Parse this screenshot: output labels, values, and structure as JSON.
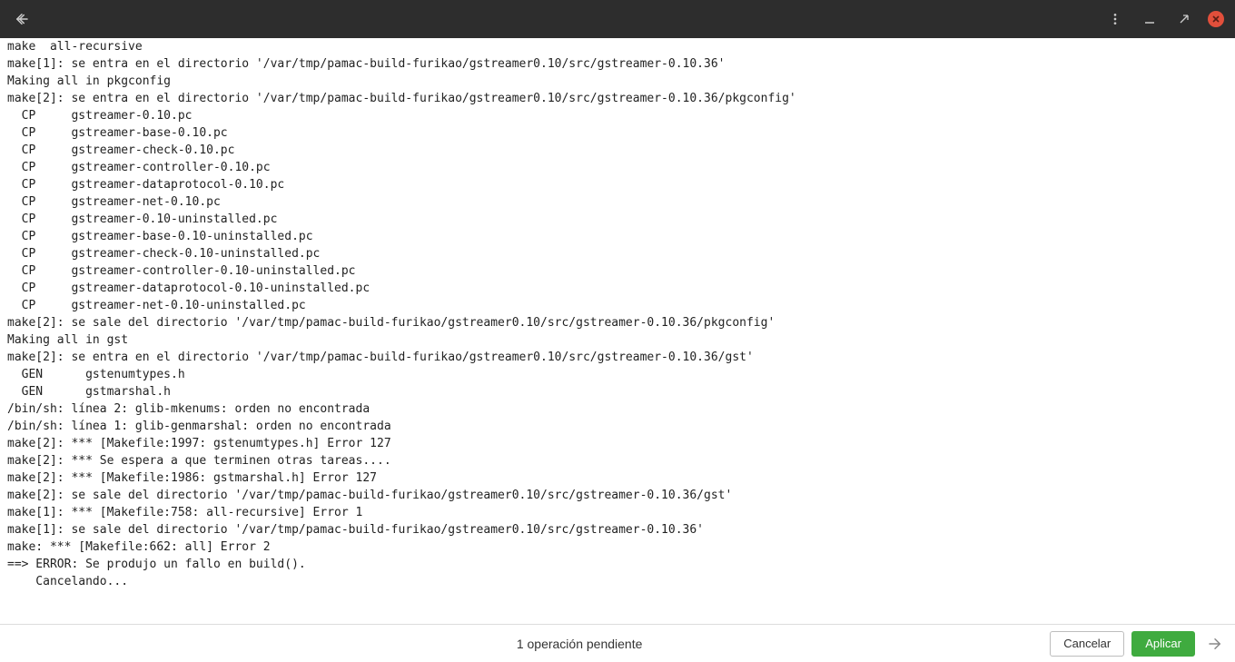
{
  "titlebar": {
    "back_icon": "back-arrow-icon",
    "menu_icon": "kebab-menu-icon",
    "minimize_icon": "minimize-icon",
    "maximize_icon": "restore-icon",
    "close_icon": "close-icon"
  },
  "terminal": {
    "lines": [
      "make  all-recursive",
      "make[1]: se entra en el directorio '/var/tmp/pamac-build-furikao/gstreamer0.10/src/gstreamer-0.10.36'",
      "Making all in pkgconfig",
      "make[2]: se entra en el directorio '/var/tmp/pamac-build-furikao/gstreamer0.10/src/gstreamer-0.10.36/pkgconfig'",
      "  CP     gstreamer-0.10.pc",
      "  CP     gstreamer-base-0.10.pc",
      "  CP     gstreamer-check-0.10.pc",
      "  CP     gstreamer-controller-0.10.pc",
      "  CP     gstreamer-dataprotocol-0.10.pc",
      "  CP     gstreamer-net-0.10.pc",
      "  CP     gstreamer-0.10-uninstalled.pc",
      "  CP     gstreamer-base-0.10-uninstalled.pc",
      "  CP     gstreamer-check-0.10-uninstalled.pc",
      "  CP     gstreamer-controller-0.10-uninstalled.pc",
      "  CP     gstreamer-dataprotocol-0.10-uninstalled.pc",
      "  CP     gstreamer-net-0.10-uninstalled.pc",
      "make[2]: se sale del directorio '/var/tmp/pamac-build-furikao/gstreamer0.10/src/gstreamer-0.10.36/pkgconfig'",
      "Making all in gst",
      "make[2]: se entra en el directorio '/var/tmp/pamac-build-furikao/gstreamer0.10/src/gstreamer-0.10.36/gst'",
      "  GEN      gstenumtypes.h",
      "  GEN      gstmarshal.h",
      "/bin/sh: línea 2: glib-mkenums: orden no encontrada",
      "/bin/sh: línea 1: glib-genmarshal: orden no encontrada",
      "make[2]: *** [Makefile:1997: gstenumtypes.h] Error 127",
      "make[2]: *** Se espera a que terminen otras tareas....",
      "make[2]: *** [Makefile:1986: gstmarshal.h] Error 127",
      "make[2]: se sale del directorio '/var/tmp/pamac-build-furikao/gstreamer0.10/src/gstreamer-0.10.36/gst'",
      "make[1]: *** [Makefile:758: all-recursive] Error 1",
      "make[1]: se sale del directorio '/var/tmp/pamac-build-furikao/gstreamer0.10/src/gstreamer-0.10.36'",
      "make: *** [Makefile:662: all] Error 2",
      "==> ERROR: Se produjo un fallo en build().",
      "    Cancelando..."
    ]
  },
  "footer": {
    "status": "1 operación pendiente",
    "cancel_label": "Cancelar",
    "apply_label": "Aplicar",
    "next_icon": "forward-arrow-icon"
  },
  "colors": {
    "titlebar_bg": "#2d2d2d",
    "close_bg": "#e24f3b",
    "apply_bg": "#3fab3f"
  }
}
